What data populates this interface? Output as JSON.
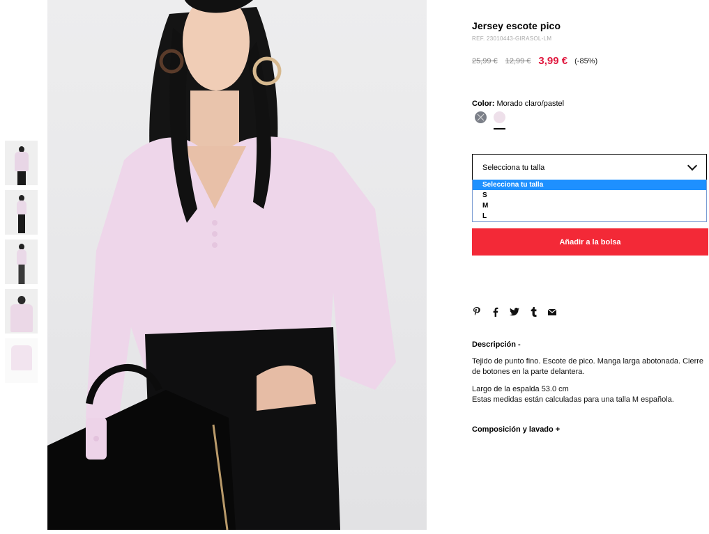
{
  "product": {
    "title": "Jersey escote pico",
    "ref": "REF. 23010443-GIRASOL-LM",
    "price_original": "25,99 €",
    "price_previous": "12,99 €",
    "price_current": "3,99 €",
    "discount": "(-85%)"
  },
  "color": {
    "label": "Color:",
    "value": "Morado claro/pastel",
    "swatches": [
      "grey-unavailable",
      "pink-selected"
    ],
    "selected_color": "#eee0ea"
  },
  "size_select": {
    "current": "Selecciona tu talla",
    "options": [
      "Selecciona tu talla",
      "S",
      "M",
      "L"
    ],
    "highlighted_index": 0
  },
  "add_to_bag": {
    "label": "Añadir a la bolsa",
    "color": "#f32937"
  },
  "share_icons": [
    "pinterest-icon",
    "facebook-icon",
    "twitter-icon",
    "tumblr-icon",
    "email-icon"
  ],
  "description": {
    "heading": "Descripción -",
    "text": "Tejido de punto fino. Escote de pico. Manga larga abotonada. Cierre de botones en la parte delantera.",
    "measure_line1": "Largo de la espalda 53.0 cm",
    "measure_line2": "Estas medidas están calculadas para una talla M española."
  },
  "composition": {
    "heading": "Composición y lavado +"
  },
  "thumbnails": [
    "thumb-1",
    "thumb-2",
    "thumb-3",
    "thumb-4",
    "thumb-5"
  ]
}
